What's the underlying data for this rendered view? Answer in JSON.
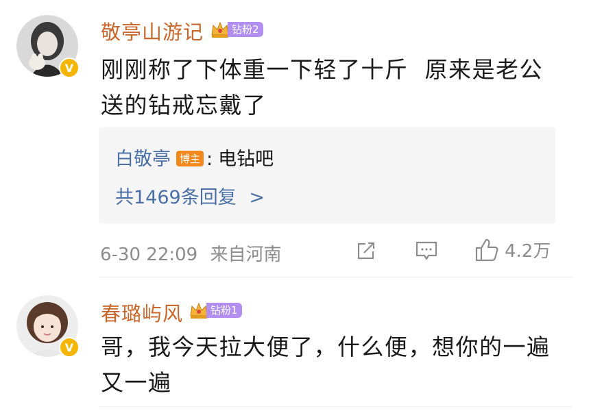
{
  "comments": [
    {
      "username": "敬亭山游记",
      "fan_badge": "钻粉2",
      "text_line1": "刚刚称了下体重一下轻了十斤  原来是老公",
      "text_line2": "送的钻戒忘戴了",
      "reply": {
        "author": "白敬亭",
        "author_tag": "博主",
        "separator": ":",
        "text": "电钻吧",
        "count_label": "共1469条回复",
        "count_arrow": ">"
      },
      "timestamp": "6-30 22:09",
      "location": "来自河南",
      "like_count": "4.2万"
    },
    {
      "username": "春璐屿风",
      "fan_badge": "钻粉1",
      "text_line1": "哥，我今天拉大便了，什么便，想你的一遍",
      "text_line2": "又一遍"
    }
  ],
  "colors": {
    "username": "#c8672b",
    "link_blue": "#4a6fa6",
    "fan_badge": "#b28ef0",
    "blogger_tag": "#f1891d",
    "verified": "#f5b600",
    "meta_gray": "#8c8c8c"
  }
}
